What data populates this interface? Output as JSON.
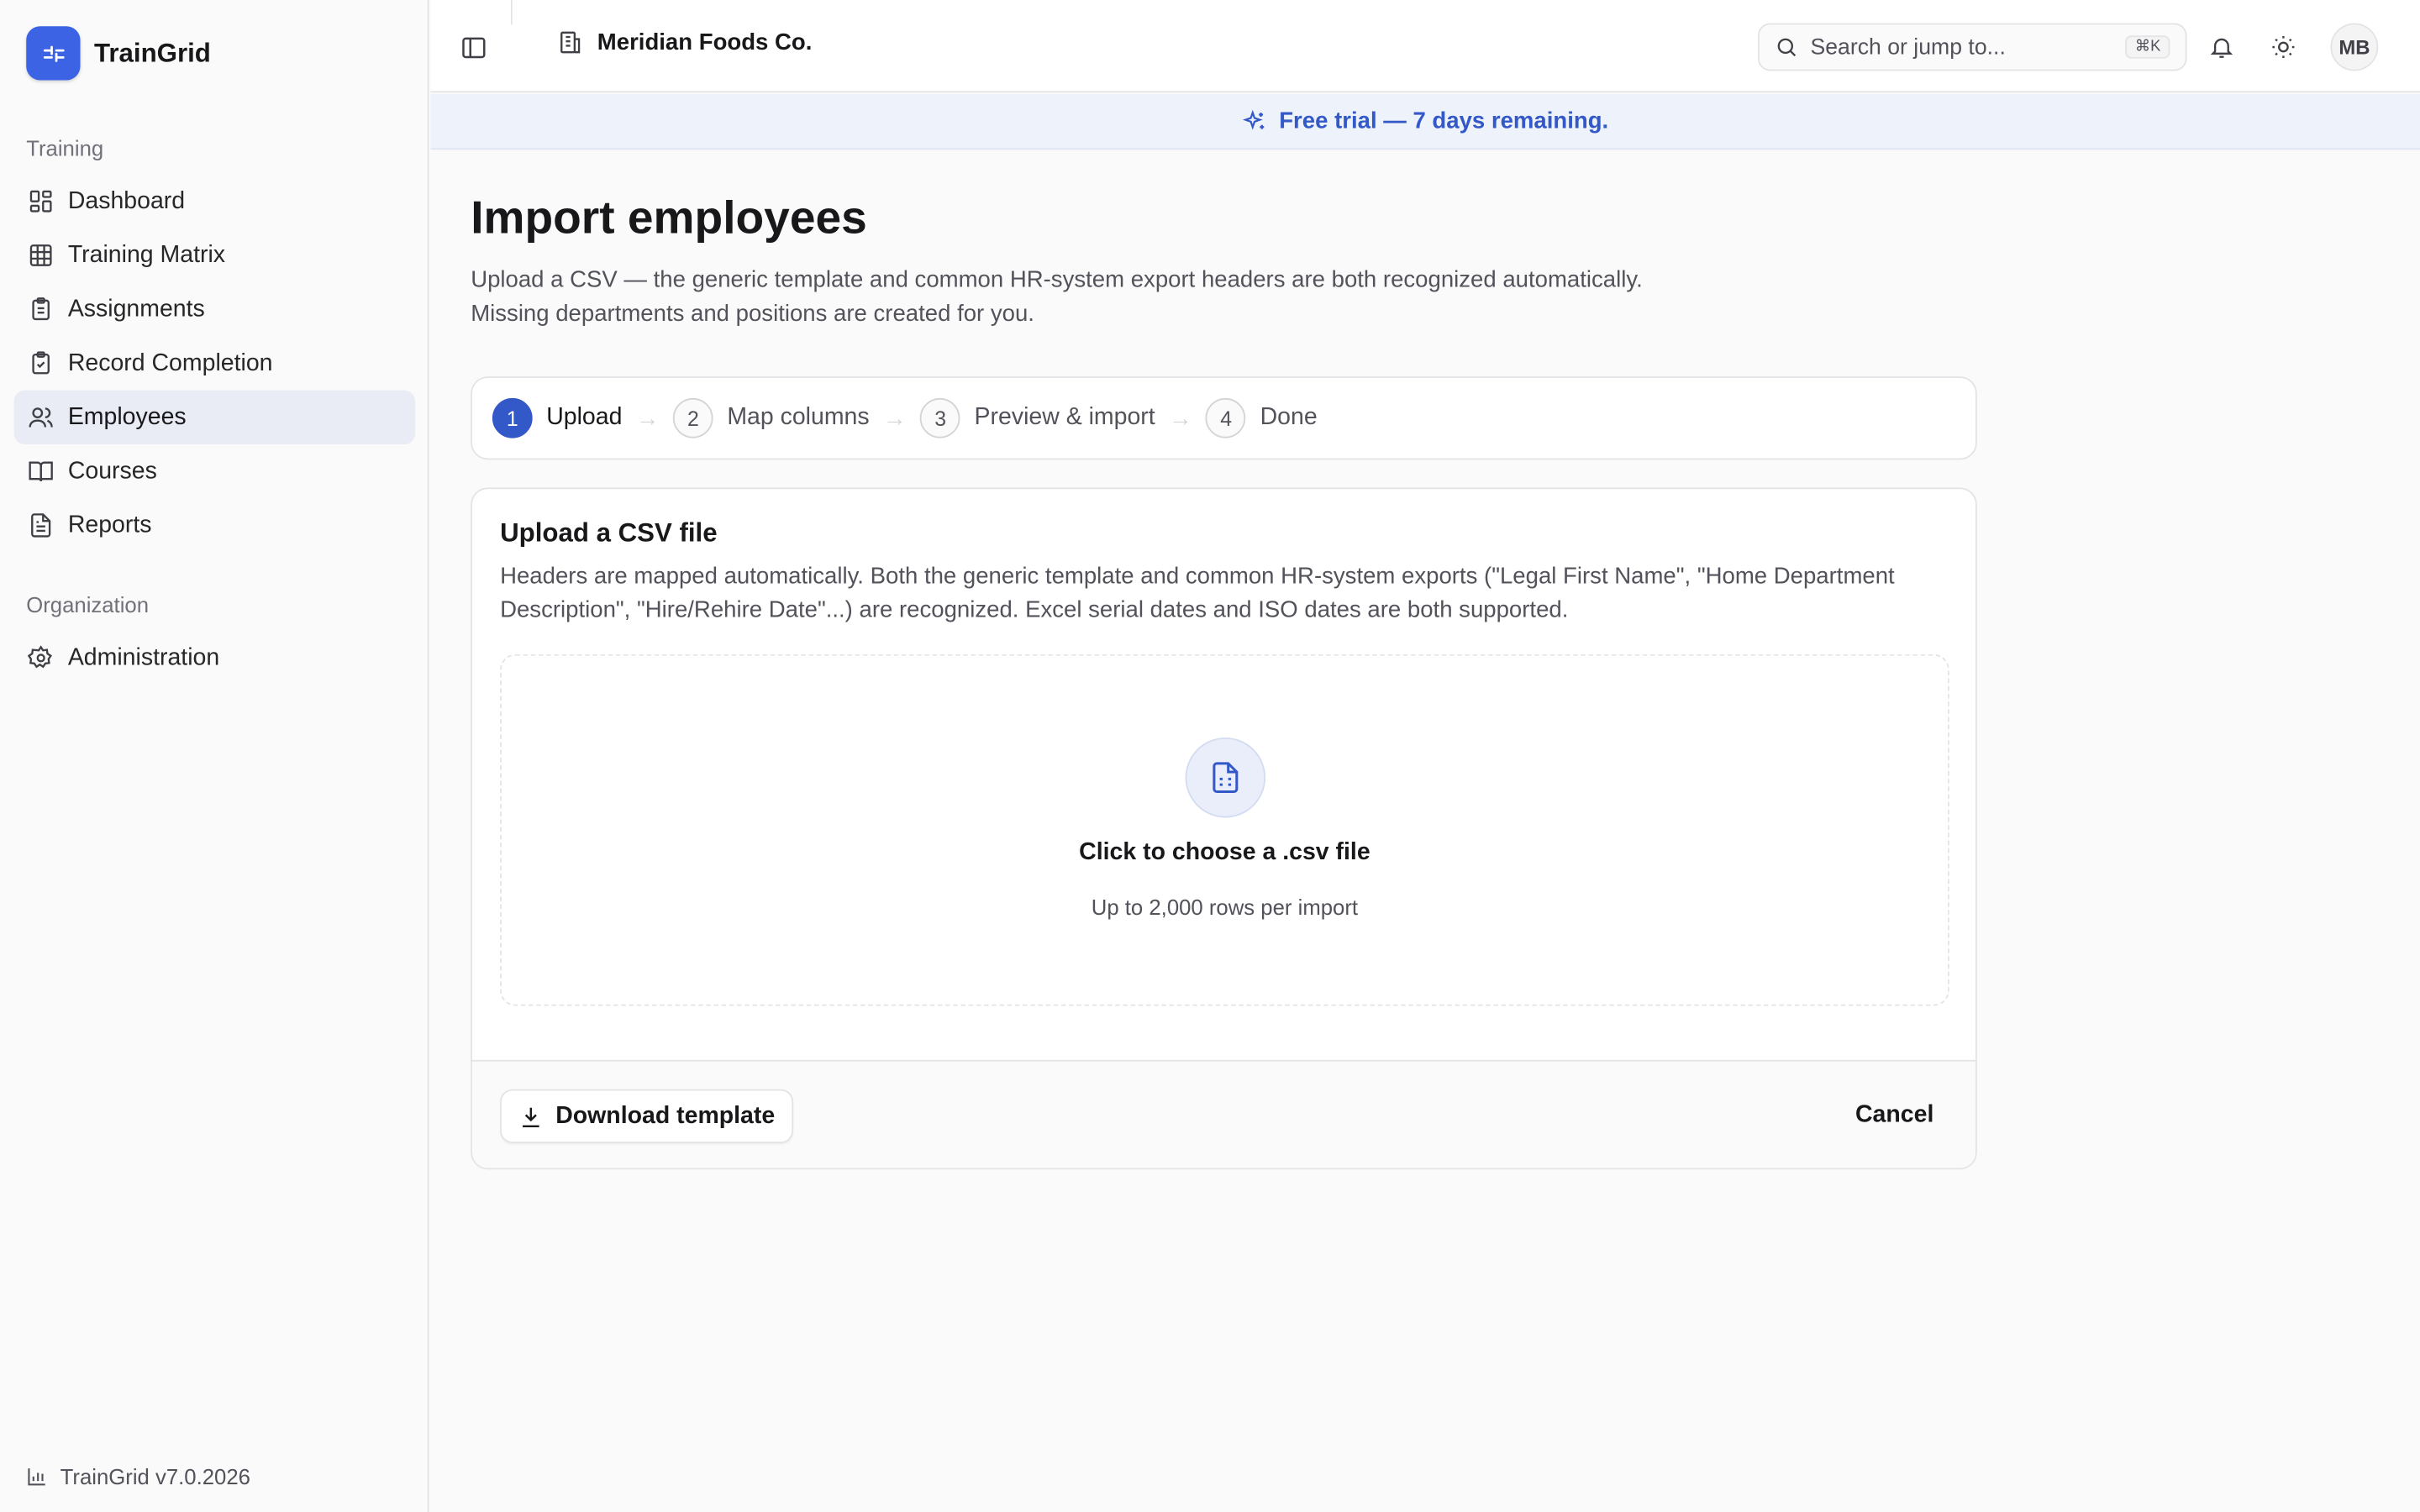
{
  "app": {
    "name": "TrainGrid",
    "version": "TrainGrid v7.0.2026"
  },
  "sidebar": {
    "groups": [
      {
        "label": "Training",
        "items": [
          {
            "label": "Dashboard",
            "icon": "dashboard-icon"
          },
          {
            "label": "Training Matrix",
            "icon": "grid-table-icon"
          },
          {
            "label": "Assignments",
            "icon": "clipboard-list-icon"
          },
          {
            "label": "Record Completion",
            "icon": "clipboard-check-icon"
          },
          {
            "label": "Employees",
            "icon": "users-icon",
            "active": true
          },
          {
            "label": "Courses",
            "icon": "book-open-icon"
          },
          {
            "label": "Reports",
            "icon": "file-text-icon"
          }
        ]
      },
      {
        "label": "Organization",
        "items": [
          {
            "label": "Administration",
            "icon": "gear-icon"
          }
        ]
      }
    ]
  },
  "topbar": {
    "org_name": "Meridian Foods Co.",
    "search_placeholder": "Search or jump to...",
    "search_shortcut": "⌘K",
    "avatar_initials": "MB"
  },
  "banner": {
    "text": "Free trial — 7 days remaining."
  },
  "page": {
    "title": "Import employees",
    "description": "Upload a CSV — the generic template and common HR-system export headers are both recognized automatically. Missing departments and positions are created for you."
  },
  "steps": [
    {
      "num": "1",
      "label": "Upload",
      "active": true
    },
    {
      "num": "2",
      "label": "Map columns"
    },
    {
      "num": "3",
      "label": "Preview & import"
    },
    {
      "num": "4",
      "label": "Done"
    }
  ],
  "upload_card": {
    "title": "Upload a CSV file",
    "description": "Headers are mapped automatically. Both the generic template and common HR-system exports (\"Legal First Name\", \"Home Department Description\", \"Hire/Rehire Date\"...) are recognized. Excel serial dates and ISO dates are both supported.",
    "dropzone_title": "Click to choose a .csv file",
    "dropzone_subtitle": "Up to 2,000 rows per import",
    "download_label": "Download template",
    "cancel_label": "Cancel"
  },
  "colors": {
    "accent": "#3358c7",
    "brand": "#3b63e4",
    "banner_bg": "#eef2fb"
  }
}
